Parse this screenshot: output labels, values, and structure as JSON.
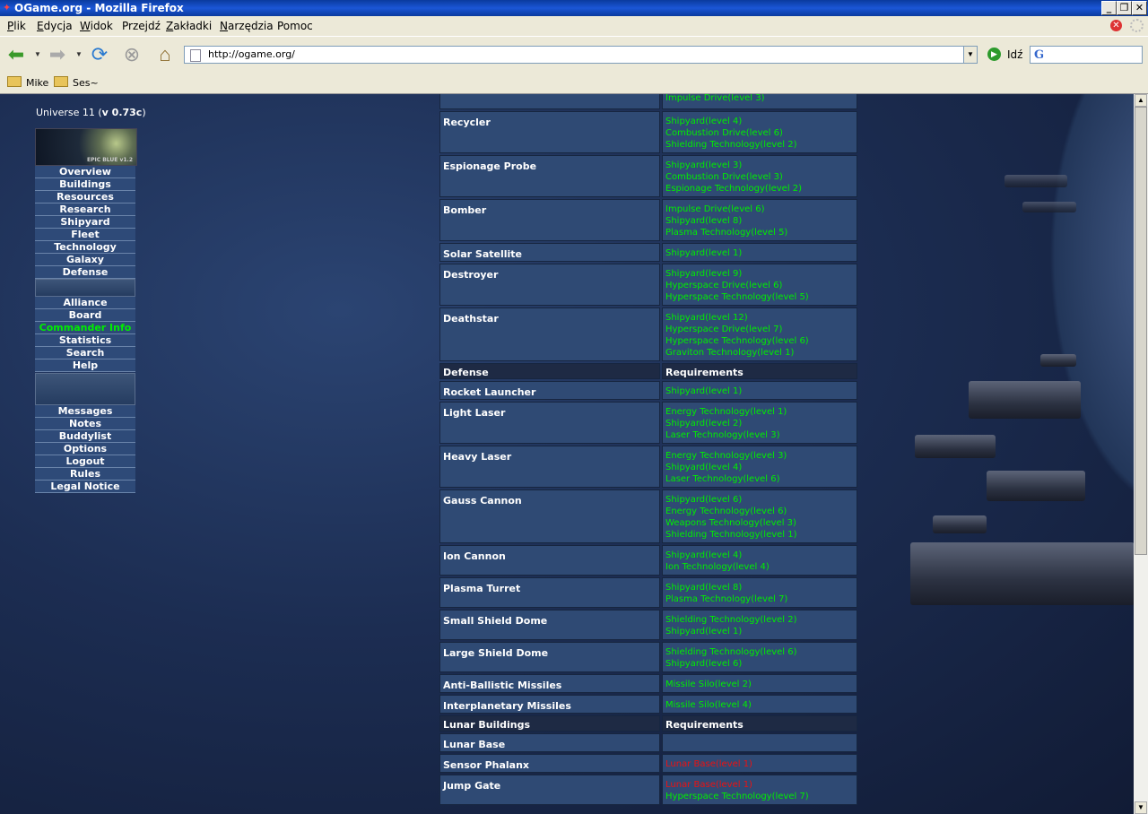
{
  "window": {
    "title": "OGame.org - Mozilla Firefox"
  },
  "menubar": [
    {
      "label": "Plik",
      "ul": "P",
      "rest": "lik"
    },
    {
      "label": "Edycja",
      "ul": "E",
      "rest": "dycja"
    },
    {
      "label": "Widok",
      "ul": "W",
      "rest": "idok"
    },
    {
      "label": "Przejdź",
      "ul": "",
      "rest": "Przejdź"
    },
    {
      "label": "Zakładki",
      "ul": "Z",
      "rest": "akładki"
    },
    {
      "label": "Narzędzia",
      "ul": "N",
      "rest": "arzędzia"
    },
    {
      "label": "Pomoc",
      "ul": "",
      "rest": "Pomoc"
    }
  ],
  "toolbar": {
    "url": "http://ogame.org/",
    "go_label": "Idź"
  },
  "bookmarks": [
    "Mike",
    "Ses~"
  ],
  "sidebar": {
    "universe_prefix": "Universe 11 (",
    "universe_version": "v 0.73c",
    "universe_suffix": ")",
    "logo_text": "EPIC BLUE v1.2",
    "group1": [
      "Overview",
      "Buildings",
      "Resources",
      "Research",
      "Shipyard",
      "Fleet",
      "Technology",
      "Galaxy",
      "Defense"
    ],
    "group2": [
      "Alliance",
      "Board",
      "Commander Info",
      "Statistics",
      "Search",
      "Help"
    ],
    "group3": [
      "Messages",
      "Notes",
      "Buddylist",
      "Options",
      "Logout",
      "Rules",
      "Legal Notice"
    ],
    "active": "Commander Info"
  },
  "table": {
    "rows": [
      {
        "name": "",
        "reqs": [
          {
            "t": "Impulse Drive(level 3)",
            "ok": true
          }
        ]
      },
      {
        "name": "Recycler",
        "reqs": [
          {
            "t": "Shipyard(level 4)",
            "ok": true
          },
          {
            "t": "Combustion Drive(level 6)",
            "ok": true
          },
          {
            "t": "Shielding Technology(level 2)",
            "ok": true
          }
        ]
      },
      {
        "name": "Espionage Probe",
        "reqs": [
          {
            "t": "Shipyard(level 3)",
            "ok": true
          },
          {
            "t": "Combustion Drive(level 3)",
            "ok": true
          },
          {
            "t": "Espionage Technology(level 2)",
            "ok": true
          }
        ]
      },
      {
        "name": "Bomber",
        "reqs": [
          {
            "t": "Impulse Drive(level 6)",
            "ok": true
          },
          {
            "t": "Shipyard(level 8)",
            "ok": true
          },
          {
            "t": "Plasma Technology(level 5)",
            "ok": true
          }
        ]
      },
      {
        "name": "Solar Satellite",
        "reqs": [
          {
            "t": "Shipyard(level 1)",
            "ok": true
          }
        ]
      },
      {
        "name": "Destroyer",
        "reqs": [
          {
            "t": "Shipyard(level 9)",
            "ok": true
          },
          {
            "t": "Hyperspace Drive(level 6)",
            "ok": true
          },
          {
            "t": "Hyperspace Technology(level 5)",
            "ok": true
          }
        ]
      },
      {
        "name": "Deathstar",
        "reqs": [
          {
            "t": "Shipyard(level 12)",
            "ok": true
          },
          {
            "t": "Hyperspace Drive(level 7)",
            "ok": true
          },
          {
            "t": "Hyperspace Technology(level 6)",
            "ok": true
          },
          {
            "t": "Graviton Technology(level 1)",
            "ok": true
          }
        ]
      },
      {
        "header": true,
        "name": "Defense",
        "reqlabel": "Requirements"
      },
      {
        "name": "Rocket Launcher",
        "reqs": [
          {
            "t": "Shipyard(level 1)",
            "ok": true
          }
        ]
      },
      {
        "name": "Light Laser",
        "reqs": [
          {
            "t": "Energy Technology(level 1)",
            "ok": true
          },
          {
            "t": "Shipyard(level 2)",
            "ok": true
          },
          {
            "t": "Laser Technology(level 3)",
            "ok": true
          }
        ]
      },
      {
        "name": "Heavy Laser",
        "reqs": [
          {
            "t": "Energy Technology(level 3)",
            "ok": true
          },
          {
            "t": "Shipyard(level 4)",
            "ok": true
          },
          {
            "t": "Laser Technology(level 6)",
            "ok": true
          }
        ]
      },
      {
        "name": "Gauss Cannon",
        "reqs": [
          {
            "t": "Shipyard(level 6)",
            "ok": true
          },
          {
            "t": "Energy Technology(level 6)",
            "ok": true
          },
          {
            "t": "Weapons Technology(level 3)",
            "ok": true
          },
          {
            "t": "Shielding Technology(level 1)",
            "ok": true
          }
        ]
      },
      {
        "name": "Ion Cannon",
        "reqs": [
          {
            "t": "Shipyard(level 4)",
            "ok": true
          },
          {
            "t": "Ion Technology(level 4)",
            "ok": true
          }
        ]
      },
      {
        "name": "Plasma Turret",
        "reqs": [
          {
            "t": "Shipyard(level 8)",
            "ok": true
          },
          {
            "t": "Plasma Technology(level 7)",
            "ok": true
          }
        ]
      },
      {
        "name": "Small Shield Dome",
        "reqs": [
          {
            "t": "Shielding Technology(level 2)",
            "ok": true
          },
          {
            "t": "Shipyard(level 1)",
            "ok": true
          }
        ]
      },
      {
        "name": "Large Shield Dome",
        "reqs": [
          {
            "t": "Shielding Technology(level 6)",
            "ok": true
          },
          {
            "t": "Shipyard(level 6)",
            "ok": true
          }
        ]
      },
      {
        "name": "Anti-Ballistic Missiles",
        "reqs": [
          {
            "t": "Missile Silo(level 2)",
            "ok": true
          }
        ]
      },
      {
        "name": "Interplanetary Missiles",
        "reqs": [
          {
            "t": "Missile Silo(level 4)",
            "ok": true
          }
        ]
      },
      {
        "header": true,
        "name": "Lunar Buildings",
        "reqlabel": "Requirements"
      },
      {
        "name": "Lunar Base",
        "reqs": []
      },
      {
        "name": "Sensor Phalanx",
        "reqs": [
          {
            "t": "Lunar Base(level 1)",
            "ok": false
          }
        ]
      },
      {
        "name": "Jump Gate",
        "reqs": [
          {
            "t": "Lunar Base(level 1)",
            "ok": false
          },
          {
            "t": "Hyperspace Technology(level 7)",
            "ok": true
          }
        ]
      }
    ]
  },
  "colors": {
    "ok": "#00ee00",
    "missing": "#ee1111",
    "cell": "#2f4a74",
    "header": "#1e2a44"
  }
}
